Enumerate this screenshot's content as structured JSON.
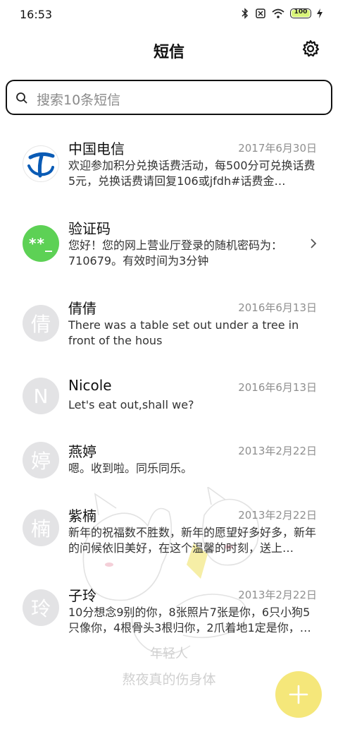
{
  "status_bar": {
    "time": "16:53",
    "battery_level": "100",
    "icons": [
      "bluetooth-icon",
      "sim-off-icon",
      "wifi-icon",
      "battery-icon",
      "charging-icon"
    ]
  },
  "header": {
    "title": "短信",
    "settings_icon": "gear-icon"
  },
  "search": {
    "placeholder": "搜索10条短信"
  },
  "messages": [
    {
      "name": "中国电信",
      "date": "2017年6月30日",
      "preview": "欢迎参加积分兑换话费活动，每500分可兑换话费5元，兑换话费请回复106或jfdh#话费金…",
      "avatar": "china-telecom-logo"
    },
    {
      "name": "验证码",
      "date": "",
      "preview": "您好！您的网上营业厅登录的随机密码为：710679。有效时间为3分钟",
      "avatar_text": "**_"
    },
    {
      "name": "倩倩",
      "date": "2016年6月13日",
      "preview": "There was a table set out under a tree in front of the hous",
      "avatar_text": "倩"
    },
    {
      "name": "Nicole",
      "date": "2016年6月13日",
      "preview": "Let's eat out,shall we?",
      "avatar_text": "N"
    },
    {
      "name": "燕婷",
      "date": "2013年2月22日",
      "preview": "嗯。收到啦。同乐同乐。",
      "avatar_text": "婷"
    },
    {
      "name": "紫楠",
      "date": "2013年2月22日",
      "preview": "新年的祝福数不胜数，新年的愿望好多好多，新年的问候依旧美好，在这个温馨的时刻，送上…",
      "avatar_text": "楠"
    },
    {
      "name": "子玲",
      "date": "2013年2月22日",
      "preview": "10分想念9别的你，8张照片7张是你，6只小狗5只像你，4根骨头3根归你，2爪着地1定是你，…",
      "avatar_text": "玲"
    }
  ],
  "watermark": {
    "line1": "年轻人",
    "line2": "熬夜真的伤身体"
  },
  "colors": {
    "accent_fab": "#f5e77a",
    "verify_avatar": "#5dd155",
    "telecom_blue": "#0a5bb5"
  }
}
